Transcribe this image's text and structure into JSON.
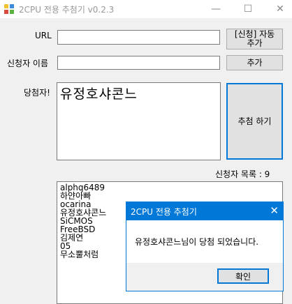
{
  "window": {
    "title": "2CPU 전용 추첨기 v0.2.3",
    "minimize_glyph": "—",
    "maximize_glyph": "☐",
    "close_glyph": "✕"
  },
  "form": {
    "url_label": "URL",
    "url_value": "",
    "auto_add_button_line1": "[신청] 자동",
    "auto_add_button_line2": "추가",
    "applicant_label": "신청자 이름",
    "applicant_value": "",
    "add_button": "추가",
    "winner_label": "당첨자!",
    "winner_value": "유정호샤콘느",
    "draw_button": "추첨 하기",
    "list_count_label": "신청자 목록 : 9"
  },
  "applicants": [
    "alphq6489",
    "하얀아빠",
    "ocarina",
    "유정호샤콘느",
    "SiCMOS",
    "FreeBSD",
    "김제연",
    "05",
    "무소뿔처럼"
  ],
  "dialog": {
    "title": "2CPU 전용 추첨기",
    "close_glyph": "✕",
    "message": "유정호샤콘느님이 당첨 되었습니다.",
    "ok_button": "확인"
  },
  "colors": {
    "accent": "#0078d7",
    "window_bg": "#f0f0f0",
    "button_bg": "#e1e1e1"
  }
}
